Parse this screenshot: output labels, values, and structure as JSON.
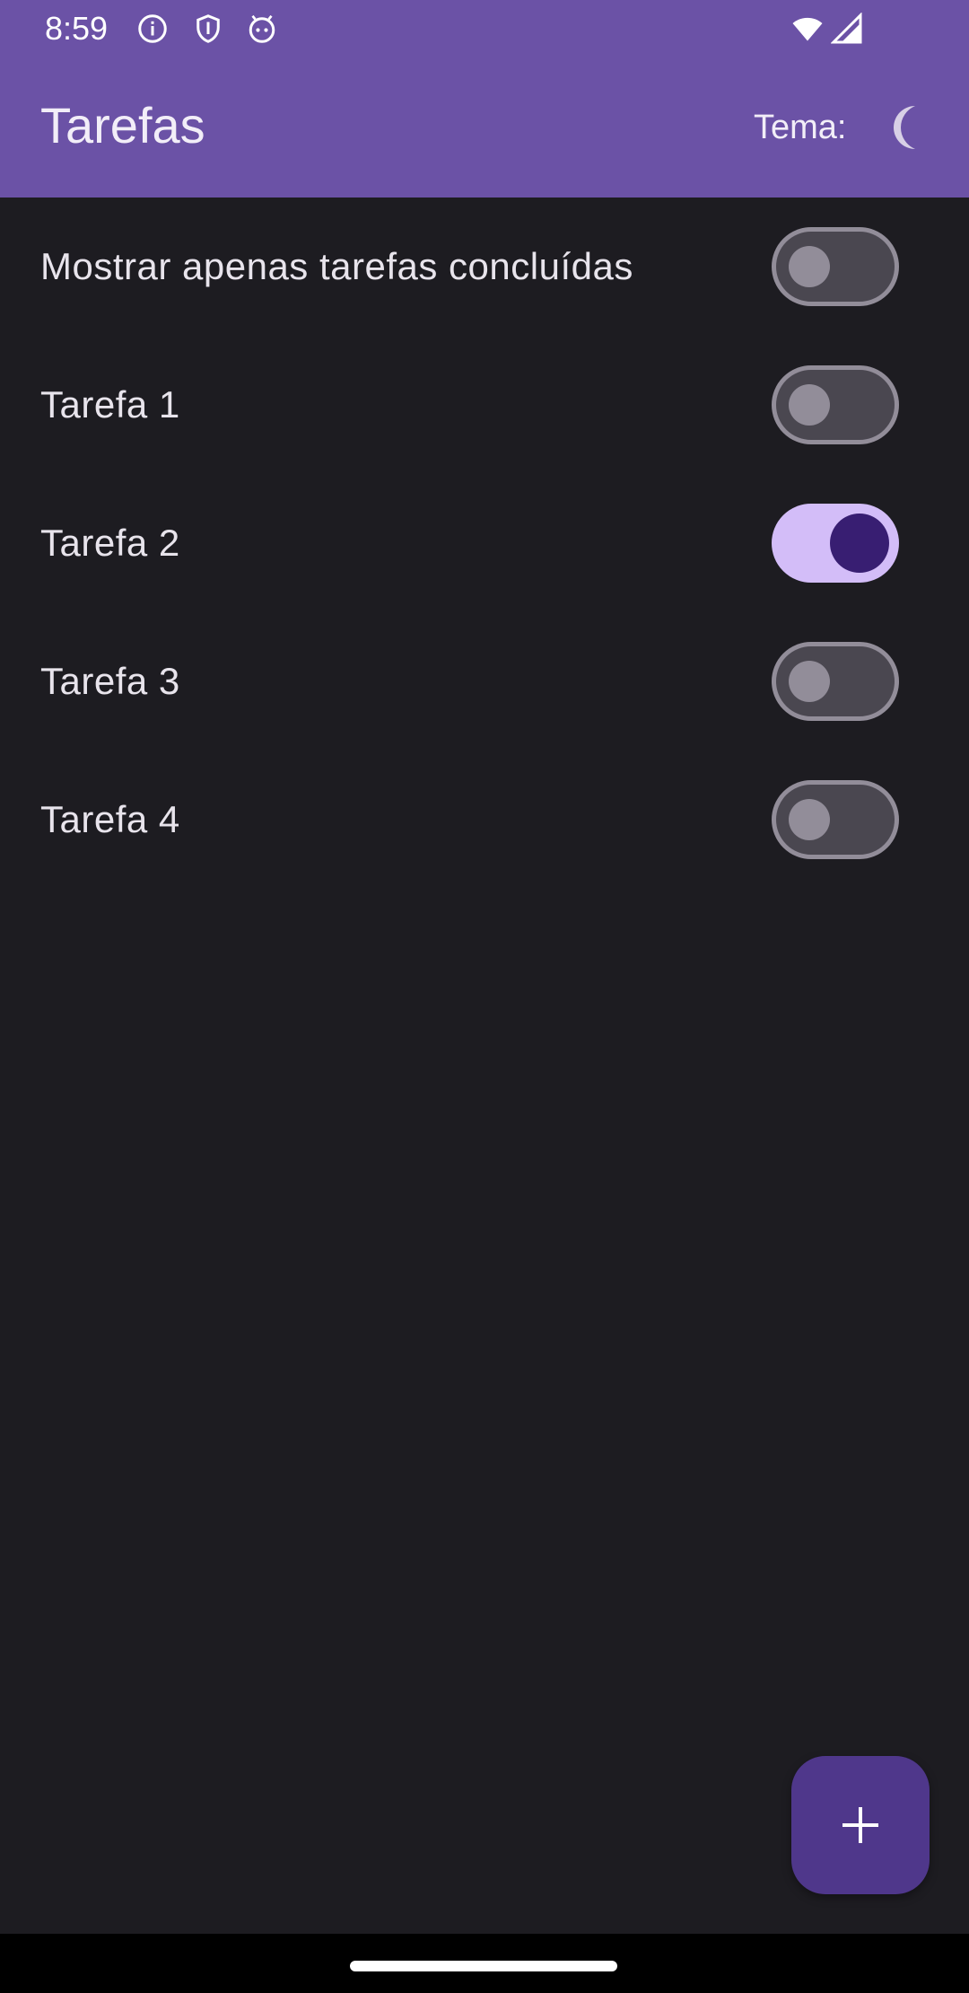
{
  "status_bar": {
    "time": "8:59",
    "icons": [
      "info-icon",
      "shield-icon",
      "android-icon",
      "wifi-icon",
      "signal-icon"
    ]
  },
  "app_bar": {
    "title": "Tarefas",
    "theme_label": "Tema:",
    "theme_icon": "moon-icon"
  },
  "list": {
    "items": [
      {
        "label": "Mostrar apenas tarefas concluídas",
        "checked": false
      },
      {
        "label": "Tarefa 1",
        "checked": false
      },
      {
        "label": "Tarefa 2",
        "checked": true
      },
      {
        "label": "Tarefa 3",
        "checked": false
      },
      {
        "label": "Tarefa 4",
        "checked": false
      }
    ]
  },
  "fab": {
    "icon": "plus-icon"
  },
  "colors": {
    "primary": "#6b52a6",
    "background": "#1d1c21",
    "switch_on_track": "#d3bdf8",
    "switch_on_thumb": "#381e72",
    "switch_off_track": "#4a4750",
    "fab": "#4f378b"
  }
}
